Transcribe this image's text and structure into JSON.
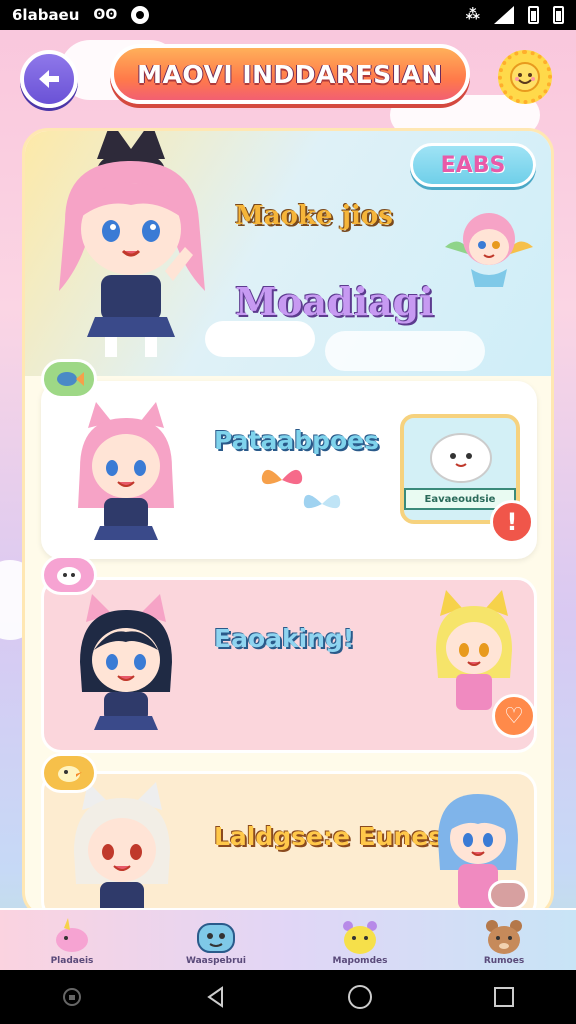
{
  "status_bar": {
    "left_text": "6labaeu",
    "left_glyph": "ʘʘ",
    "icons": [
      "record-icon",
      "cast-icon",
      "signal-icon",
      "battery-icon",
      "battery-icon"
    ]
  },
  "header": {
    "title": "MAOVI INDDARESIAN",
    "back_icon": "back-arrow-icon",
    "settings_icon": "sun-face-icon"
  },
  "hero": {
    "badge": "EABS",
    "title": "Maoke jios",
    "subtitle": "Moadiagi"
  },
  "cards": [
    {
      "title": "Pataabpoes",
      "notice": "Eavaeoudsie",
      "action_icon": "alert-icon",
      "action_label": "!"
    },
    {
      "title": "Eaoaking!",
      "action_icon": "heart-icon",
      "action_label": "♡"
    },
    {
      "title": "Laldgse:e Eunes",
      "action_icon": "chat-bubble-icon"
    }
  ],
  "bottom_nav": [
    {
      "label": "Pladaeis",
      "icon": "unicorn-icon"
    },
    {
      "label": "Waaspebrui",
      "icon": "blue-monster-icon"
    },
    {
      "label": "Mapomdes",
      "icon": "yellow-creature-icon"
    },
    {
      "label": "Rumoes",
      "icon": "bear-icon"
    }
  ],
  "colors": {
    "title_pill": "#ff7a4a",
    "back_button": "#6a52d6",
    "badge": "#6fcfe9",
    "alert": "#f0564a",
    "heart": "#ff8a4a"
  }
}
